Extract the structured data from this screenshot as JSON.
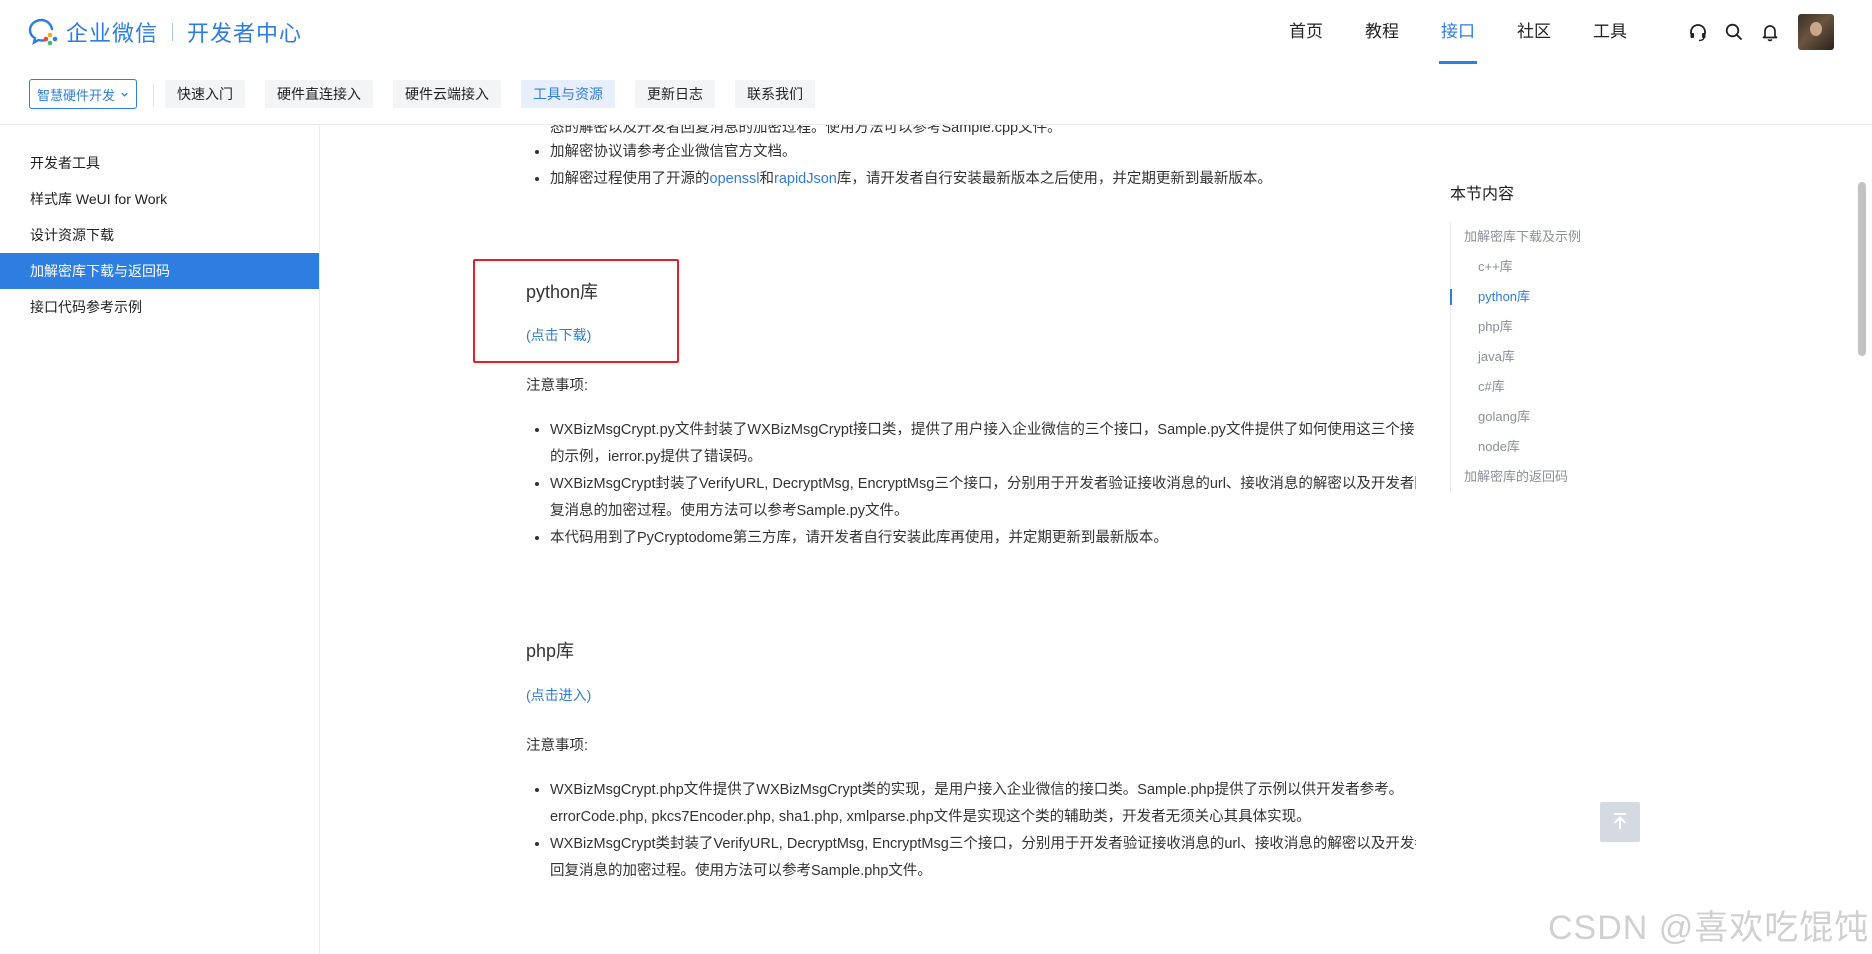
{
  "header": {
    "brand": "企业微信",
    "subtitle": "开发者中心",
    "nav": [
      {
        "label": "首页",
        "active": false
      },
      {
        "label": "教程",
        "active": false
      },
      {
        "label": "接口",
        "active": true
      },
      {
        "label": "社区",
        "active": false
      },
      {
        "label": "工具",
        "active": false
      }
    ],
    "icons": [
      "headset-icon",
      "search-icon",
      "bell-icon"
    ],
    "accent_color": "#2e7de0"
  },
  "subnav": {
    "dropdown_label": "智慧硬件开发",
    "tabs": [
      {
        "label": "快速入门",
        "active": false
      },
      {
        "label": "硬件直连接入",
        "active": false
      },
      {
        "label": "硬件云端接入",
        "active": false
      },
      {
        "label": "工具与资源",
        "active": true
      },
      {
        "label": "更新日志",
        "active": false
      },
      {
        "label": "联系我们",
        "active": false
      }
    ]
  },
  "sidebar": {
    "items": [
      {
        "label": "开发者工具",
        "active": false
      },
      {
        "label": "样式库 WeUI for Work",
        "active": false
      },
      {
        "label": "设计资源下载",
        "active": false
      },
      {
        "label": "加解密库下载与返回码",
        "active": true
      },
      {
        "label": "接口代码参考示例",
        "active": false
      }
    ]
  },
  "content": {
    "top_partial": "态的解密以及开发者回复消息的加密过程。使用方法可以参考Sample.cpp文件。",
    "top_bullets": {
      "b1": "加解密协议请参考企业微信官方文档。",
      "b2_pre": "加解密过程使用了开源的",
      "b2_link1": "openssl",
      "b2_mid": "和",
      "b2_link2": "rapidJson",
      "b2_post": "库，请开发者自行安装最新版本之后使用，并定期更新到最新版本。"
    },
    "python": {
      "title": "python库",
      "download": "(点击下载)",
      "note_label": "注意事项:",
      "bullets": [
        "WXBizMsgCrypt.py文件封装了WXBizMsgCrypt接口类，提供了用户接入企业微信的三个接口，Sample.py文件提供了如何使用这三个接口的示例，ierror.py提供了错误码。",
        "WXBizMsgCrypt封装了VerifyURL, DecryptMsg, EncryptMsg三个接口，分别用于开发者验证接收消息的url、接收消息的解密以及开发者回复消息的加密过程。使用方法可以参考Sample.py文件。",
        "本代码用到了PyCryptodome第三方库，请开发者自行安装此库再使用，并定期更新到最新版本。"
      ]
    },
    "php": {
      "title": "php库",
      "download": "(点击进入)",
      "note_label": "注意事项:",
      "bullets": [
        "WXBizMsgCrypt.php文件提供了WXBizMsgCrypt类的实现，是用户接入企业微信的接口类。Sample.php提供了示例以供开发者参考。errorCode.php, pkcs7Encoder.php, sha1.php, xmlparse.php文件是实现这个类的辅助类，开发者无须关心其具体实现。",
        "WXBizMsgCrypt类封装了VerifyURL, DecryptMsg, EncryptMsg三个接口，分别用于开发者验证接收消息的url、接收消息的解密以及开发者回复消息的加密过程。使用方法可以参考Sample.php文件。"
      ]
    }
  },
  "toc": {
    "title": "本节内容",
    "items": [
      {
        "label": "加解密库下载及示例",
        "level": 1,
        "active": false
      },
      {
        "label": "c++库",
        "level": 2,
        "active": false
      },
      {
        "label": "python库",
        "level": 2,
        "active": true
      },
      {
        "label": "php库",
        "level": 2,
        "active": false
      },
      {
        "label": "java库",
        "level": 2,
        "active": false
      },
      {
        "label": "c#库",
        "level": 2,
        "active": false
      },
      {
        "label": "golang库",
        "level": 2,
        "active": false
      },
      {
        "label": "node库",
        "level": 2,
        "active": false
      },
      {
        "label": "加解密库的返回码",
        "level": 1,
        "active": false
      }
    ]
  },
  "highlight_color": "#e0202a",
  "watermark": "CSDN @喜欢吃馄饨"
}
